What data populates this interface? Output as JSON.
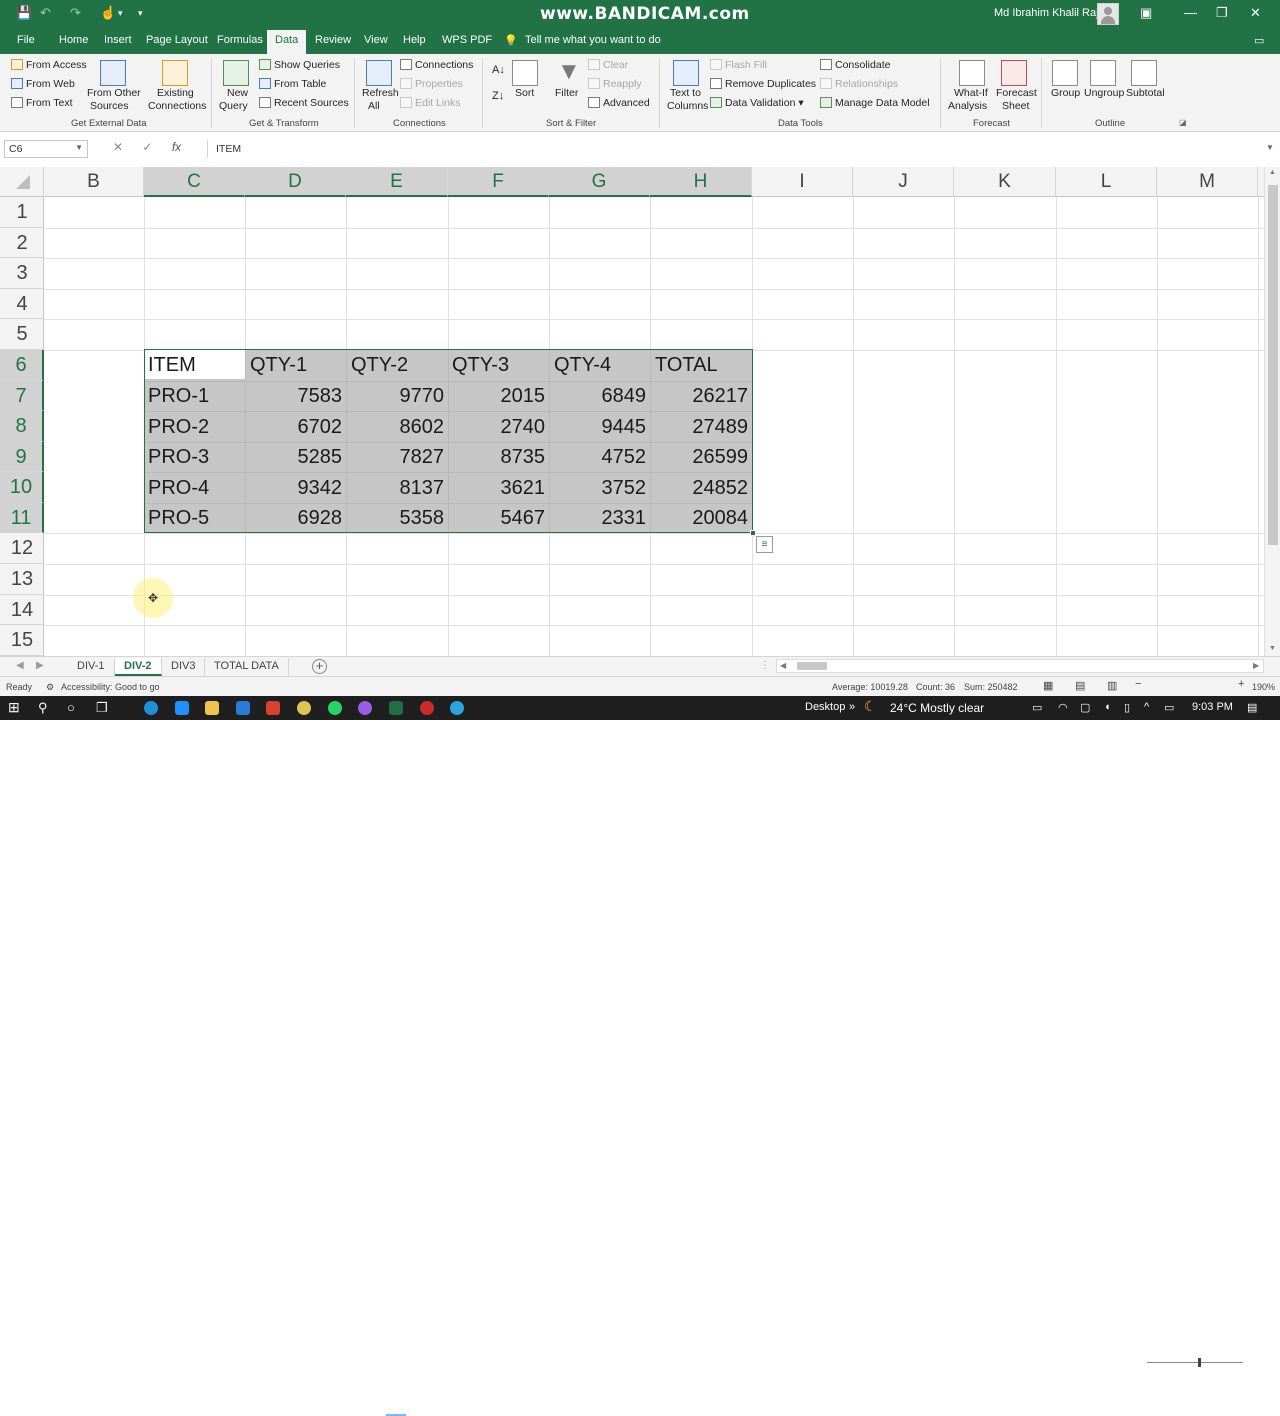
{
  "window": {
    "watermark": "www.BANDICAM.com",
    "user_name": "Md Ibrahim Khalil Raj",
    "minimize": "—",
    "maximize": "❐",
    "close": "✕"
  },
  "qat": {
    "save": "💾",
    "undo": "↶",
    "redo": "↷",
    "touch": "☝",
    "more": "▾"
  },
  "tabs": [
    "File",
    "Home",
    "Insert",
    "Page Layout",
    "Formulas",
    "Data",
    "Review",
    "View",
    "Help",
    "WPS PDF"
  ],
  "tell_me": "Tell me what you want to do",
  "ribbon": {
    "get_external": {
      "from_access": "From Access",
      "from_web": "From Web",
      "from_text": "From Text",
      "from_other_1": "From Other",
      "from_other_2": "Sources",
      "existing_1": "Existing",
      "existing_2": "Connections",
      "label": "Get External Data"
    },
    "transform": {
      "new_query_1": "New",
      "new_query_2": "Query",
      "show_queries": "Show Queries",
      "from_table": "From Table",
      "recent_sources": "Recent Sources",
      "label": "Get & Transform"
    },
    "connections": {
      "refresh_1": "Refresh",
      "refresh_2": "All",
      "connections": "Connections",
      "properties": "Properties",
      "edit_links": "Edit Links",
      "label": "Connections"
    },
    "sort_filter": {
      "sort": "Sort",
      "filter": "Filter",
      "clear": "Clear",
      "reapply": "Reapply",
      "advanced": "Advanced",
      "label": "Sort & Filter"
    },
    "data_tools": {
      "text_to_1": "Text to",
      "text_to_2": "Columns",
      "flash_fill": "Flash Fill",
      "remove_duplicates": "Remove Duplicates",
      "data_validation": "Data Validation",
      "consolidate": "Consolidate",
      "relationships": "Relationships",
      "manage_model": "Manage Data Model",
      "label": "Data Tools"
    },
    "forecast": {
      "whatif_1": "What-If",
      "whatif_2": "Analysis",
      "sheet_1": "Forecast",
      "sheet_2": "Sheet",
      "label": "Forecast"
    },
    "outline": {
      "group": "Group",
      "ungroup": "Ungroup",
      "subtotal": "Subtotal",
      "label": "Outline"
    }
  },
  "formula_bar": {
    "name_box": "C6",
    "cancel": "✕",
    "enter": "✓",
    "fx": "fx",
    "formula": "ITEM"
  },
  "columns": [
    "B",
    "C",
    "D",
    "E",
    "F",
    "G",
    "H",
    "I",
    "J",
    "K",
    "L",
    "M"
  ],
  "rows": [
    "1",
    "2",
    "3",
    "4",
    "5",
    "6",
    "7",
    "8",
    "9",
    "10",
    "11",
    "12",
    "13",
    "14",
    "15"
  ],
  "table": {
    "headers": [
      "ITEM",
      "QTY-1",
      "QTY-2",
      "QTY-3",
      "QTY-4",
      "TOTAL"
    ],
    "rows": [
      [
        "PRO-1",
        "7583",
        "9770",
        "2015",
        "6849",
        "26217"
      ],
      [
        "PRO-2",
        "6702",
        "8602",
        "2740",
        "9445",
        "27489"
      ],
      [
        "PRO-3",
        "5285",
        "7827",
        "8735",
        "4752",
        "26599"
      ],
      [
        "PRO-4",
        "9342",
        "8137",
        "3621",
        "3752",
        "24852"
      ],
      [
        "PRO-5",
        "6928",
        "5358",
        "5467",
        "2331",
        "20084"
      ]
    ]
  },
  "sheets": [
    "DIV-1",
    "DIV-2",
    "DIV3",
    "TOTAL DATA"
  ],
  "active_sheet": "DIV-2",
  "status": {
    "ready": "Ready",
    "accessibility": "Accessibility: Good to go",
    "average": "Average: 10019.28",
    "count": "Count: 36",
    "sum": "Sum: 250482",
    "zoom": "190%"
  },
  "taskbar": {
    "desktop": "Desktop",
    "weather": "24°C  Mostly clear",
    "time": "9:03 PM"
  },
  "colors": {
    "accent": "#217346",
    "selection": "#c6c6c6"
  }
}
